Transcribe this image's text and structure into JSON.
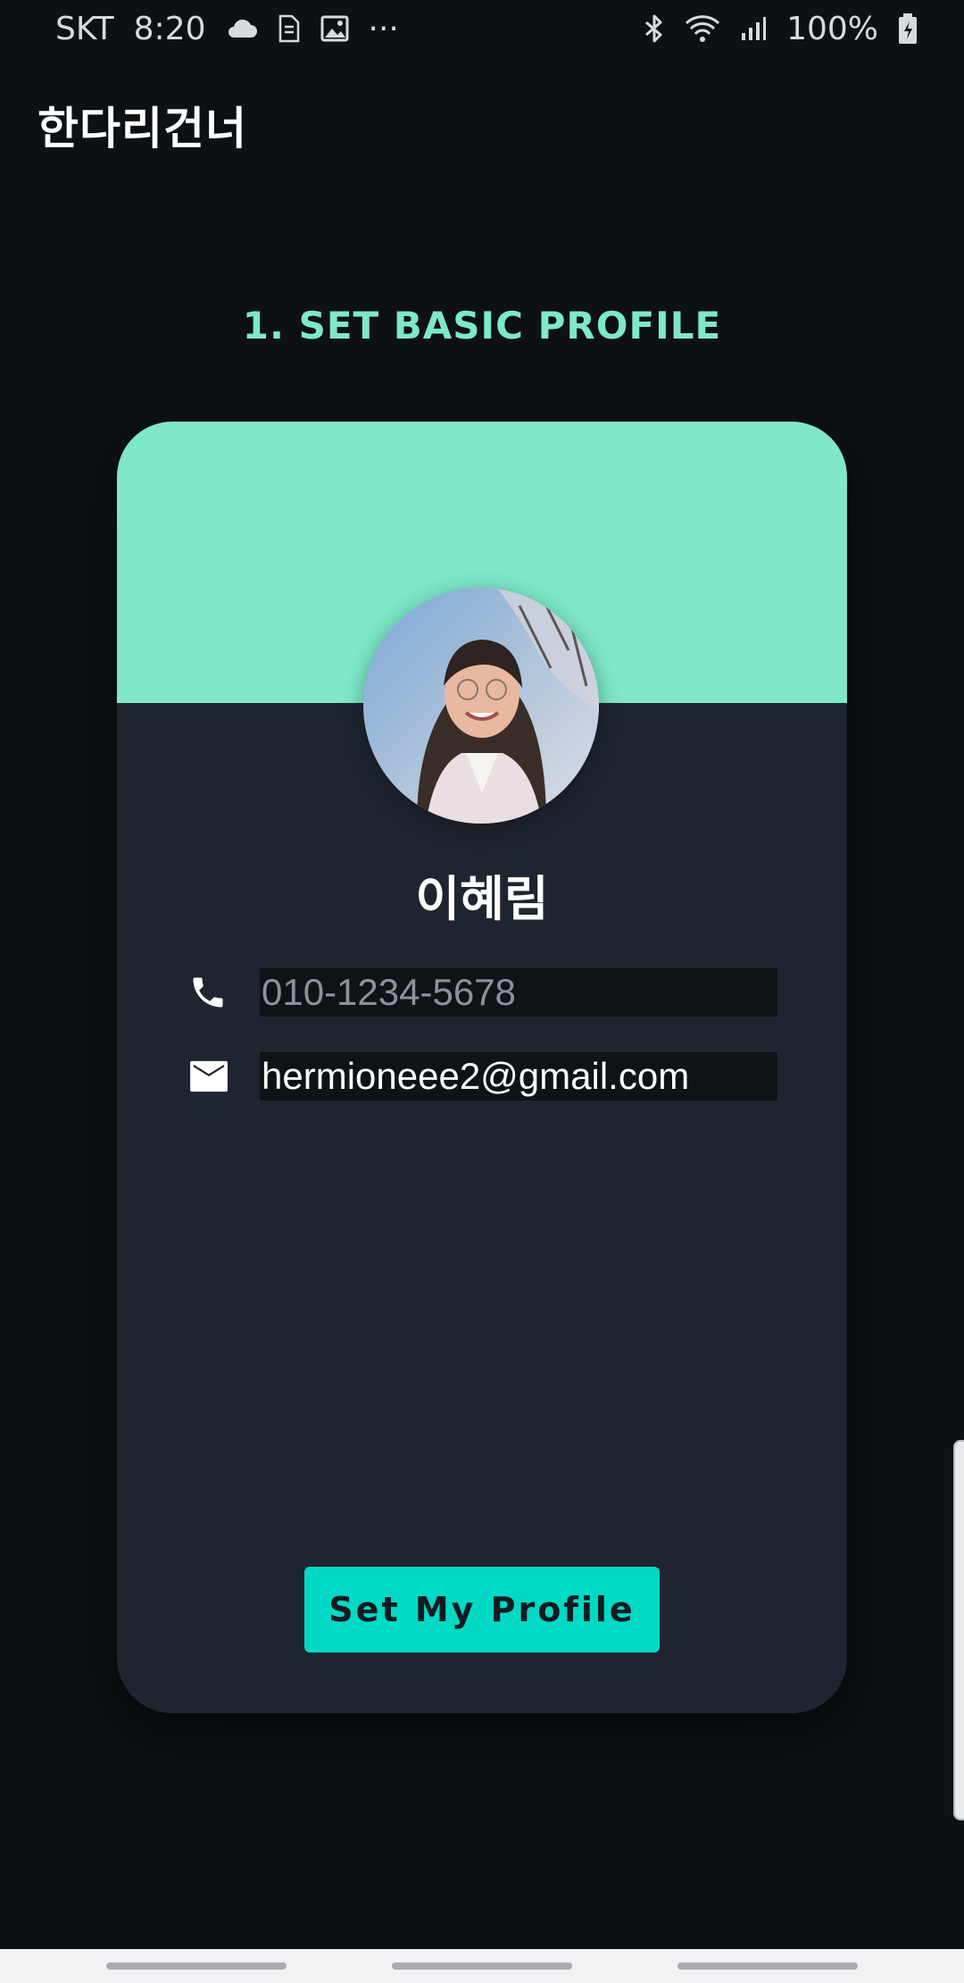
{
  "status_bar": {
    "carrier": "SKT",
    "time": "8:20",
    "more": "···",
    "battery": "100%"
  },
  "app": {
    "title": "한다리건너"
  },
  "step": {
    "title": "1. SET BASIC PROFILE"
  },
  "profile": {
    "name": "이혜림",
    "phone_placeholder": "010-1234-5678",
    "email": "hermioneee2@gmail.com"
  },
  "actions": {
    "set_profile_label": "Set My Profile"
  },
  "colors": {
    "accent": "#7ee8c8",
    "button": "#00d9c4",
    "card": "#1f2530",
    "background": "#0d1115"
  },
  "icons": {
    "phone": "phone-icon",
    "email": "mail-icon"
  }
}
